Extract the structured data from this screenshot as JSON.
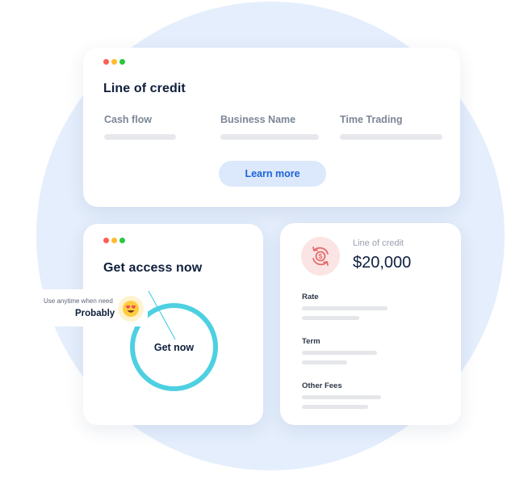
{
  "colors": {
    "background_circle": "#e4eefc",
    "window_dots": [
      "#ff5f57",
      "#febc2e",
      "#28c840"
    ],
    "accent_blue": "#1d63d6",
    "button_bg": "#dce8fb",
    "ring": "#4dd0e1",
    "icon_bg": "#fbe4e4",
    "icon_fg": "#e36b6b"
  },
  "top_card": {
    "title": "Line of credit",
    "fields": [
      "Cash flow",
      "Business Name",
      "Time Trading"
    ],
    "learn_more": "Learn more"
  },
  "access_card": {
    "title": "Get access now",
    "cta": "Get now"
  },
  "tooltip": {
    "hint": "Use anytime when need",
    "answer": "Probably",
    "emoji_icon": "heart-eyes-emoji-icon"
  },
  "credit_card": {
    "label": "Line of credit",
    "amount": "$20,000",
    "icon": "dollar-refresh-icon",
    "rows": [
      "Rate",
      "Term",
      "Other Fees"
    ]
  }
}
